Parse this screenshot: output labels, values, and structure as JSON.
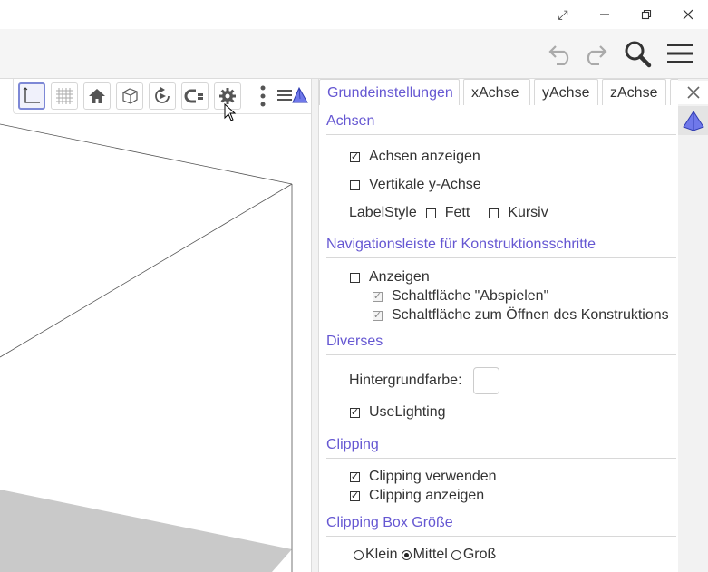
{
  "window": {
    "maximize_glyph": "⤢",
    "minimize_glyph": "—",
    "restore_glyph": "❐",
    "close_glyph": "✕"
  },
  "colors": {
    "accent": "#6557d2",
    "pyramid_fill": "#6f78ea",
    "plane": "#c9c9c9"
  },
  "panel": {
    "tabs": [
      {
        "label": "Grundeinstellungen"
      },
      {
        "label": "xAchse"
      },
      {
        "label": "yAchse"
      },
      {
        "label": "zAchse"
      }
    ],
    "close_glyph": "✕",
    "sections": {
      "achsen": {
        "title": "Achsen",
        "show_axes": {
          "label": "Achsen anzeigen",
          "checked": true
        },
        "vertical_y": {
          "label": "Vertikale y-Achse",
          "checked": false
        },
        "labelstyle": {
          "label": "LabelStyle",
          "bold": "Fett",
          "italic": "Kursiv"
        }
      },
      "navigation": {
        "title": "Navigationsleiste für Konstruktionsschritte",
        "show": {
          "label": "Anzeigen",
          "checked": false
        },
        "play_button": {
          "label": "Schaltfläche \"Abspielen\"",
          "checked": true
        },
        "open_button": {
          "label": "Schaltfläche zum Öffnen des Konstruktions",
          "checked": true
        }
      },
      "diverses": {
        "title": "Diverses",
        "background_label": "Hintergrundfarbe:",
        "use_lighting": {
          "label": "UseLighting",
          "checked": true
        }
      },
      "clipping": {
        "title": "Clipping",
        "use": {
          "label": "Clipping verwenden",
          "checked": true
        },
        "show": {
          "label": "Clipping anzeigen",
          "checked": true
        }
      },
      "clipping_box": {
        "title": "Clipping Box Größe",
        "options": [
          {
            "label": "Klein",
            "selected": false
          },
          {
            "label": "Mittel",
            "selected": true
          },
          {
            "label": "Groß",
            "selected": false
          }
        ]
      }
    }
  }
}
